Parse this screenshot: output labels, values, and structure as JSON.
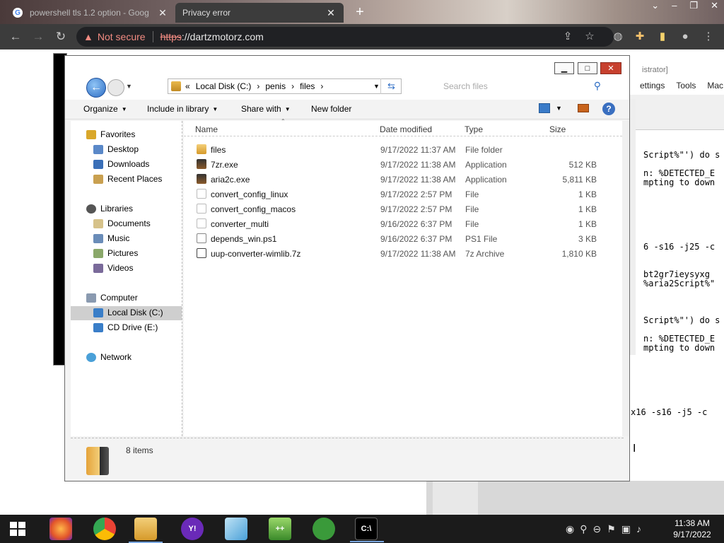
{
  "browser": {
    "tabs": [
      {
        "title": "powershell tls 1.2 option - Goog",
        "active": false
      },
      {
        "title": "Privacy error",
        "active": true
      }
    ],
    "omnibox": {
      "security_label": "Not secure",
      "scheme": "https",
      "rest": "://dartzmotorz.com"
    },
    "colors": {
      "chrome_dark": "#3c3c3c",
      "not_secure": "#f28b82"
    }
  },
  "background_window": {
    "title_fragment": "istrator]",
    "menu": [
      "ettings",
      "Tools",
      "Mac"
    ],
    "code_lines": [
      {
        "text": "Script%\"') do s",
        "row": 1
      },
      {
        "text": "n: %DETECTED_E",
        "row": 2
      },
      {
        "text": "mpting to down",
        "row": 3
      },
      {
        "text": "6 -s16 -j25 -c",
        "row": 4
      },
      {
        "text": "bt2gr7ieysyxg",
        "row": 5
      },
      {
        "text": "%aria2Script%\"",
        "row": 6
      },
      {
        "text": "Script%\"') do s",
        "row": 7
      },
      {
        "text": "n: %DETECTED_E",
        "row": 8
      },
      {
        "text": "mpting to down",
        "row": 9
      },
      {
        "text": "x16 -s16 -j5 -c",
        "row": 10
      }
    ]
  },
  "explorer": {
    "breadcrumb": [
      "«",
      "Local Disk (C:)",
      "penis",
      "files"
    ],
    "search_placeholder": "Search files",
    "commands": {
      "organize": "Organize",
      "include_in_library": "Include in library",
      "share_with": "Share with",
      "new_folder": "New folder"
    },
    "nav": {
      "favorites": "Favorites",
      "desktop": "Desktop",
      "downloads": "Downloads",
      "recent_places": "Recent Places",
      "libraries": "Libraries",
      "documents": "Documents",
      "music": "Music",
      "pictures": "Pictures",
      "videos": "Videos",
      "computer": "Computer",
      "local_disk": "Local Disk (C:)",
      "cd_drive": "CD Drive (E:)",
      "network": "Network"
    },
    "columns": {
      "name": "Name",
      "date_modified": "Date modified",
      "type": "Type",
      "size": "Size"
    },
    "files": [
      {
        "name": "files",
        "date": "9/17/2022 11:37 AM",
        "type": "File folder",
        "size": "",
        "icon": "folder-icon"
      },
      {
        "name": "7zr.exe",
        "date": "9/17/2022 11:38 AM",
        "type": "Application",
        "size": "512 KB",
        "icon": "exe-icon"
      },
      {
        "name": "aria2c.exe",
        "date": "9/17/2022 11:38 AM",
        "type": "Application",
        "size": "5,811 KB",
        "icon": "exe-icon"
      },
      {
        "name": "convert_config_linux",
        "date": "9/17/2022 2:57 PM",
        "type": "File",
        "size": "1 KB",
        "icon": "file-icon"
      },
      {
        "name": "convert_config_macos",
        "date": "9/17/2022 2:57 PM",
        "type": "File",
        "size": "1 KB",
        "icon": "file-icon"
      },
      {
        "name": "converter_multi",
        "date": "9/16/2022 6:37 PM",
        "type": "File",
        "size": "1 KB",
        "icon": "file-icon"
      },
      {
        "name": "depends_win.ps1",
        "date": "9/16/2022 6:37 PM",
        "type": "PS1 File",
        "size": "3 KB",
        "icon": "ps1-icon"
      },
      {
        "name": "uup-converter-wimlib.7z",
        "date": "9/17/2022 11:38 AM",
        "type": "7z Archive",
        "size": "1,810 KB",
        "icon": "archive-icon"
      }
    ],
    "item_count": "8 items"
  },
  "taskbar": {
    "apps": [
      "firefox-icon",
      "chrome-icon",
      "file-explorer-icon",
      "yahoo-messenger-icon",
      "notepad-icon",
      "notepad-plus-plus-icon",
      "frog-app-icon",
      "cmd-icon"
    ],
    "clock_time": "11:38 AM",
    "clock_date": "9/17/2022"
  }
}
